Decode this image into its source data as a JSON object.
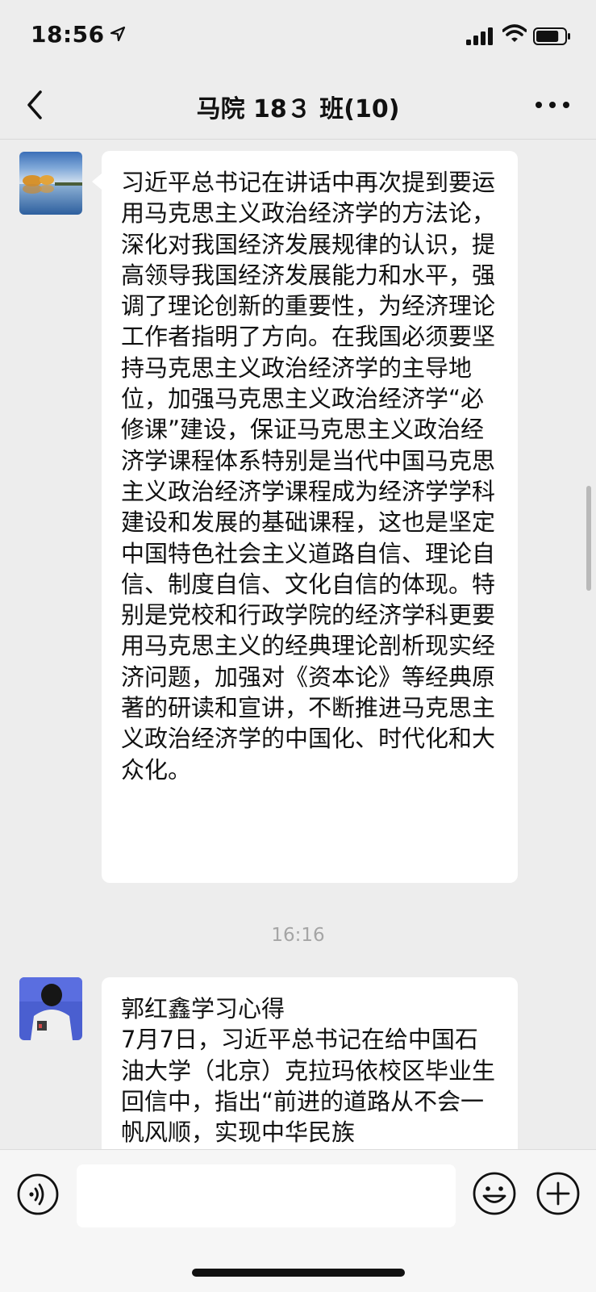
{
  "status_bar": {
    "time": "18:56",
    "location_icon": "location-arrow-icon",
    "battery_level": 0.8
  },
  "nav": {
    "title": "马院 18３ 班(10)",
    "back_icon": "chevron-left-icon",
    "more_icon": "ellipsis-icon"
  },
  "messages": [
    {
      "avatar": "landscape-avatar",
      "text": "习近平总书记在讲话中再次提到要运用马克思主义政治经济学的方法论，深化对我国经济发展规律的认识，提高领导我国经济发展能力和水平，强调了理论创新的重要性，为经济理论工作者指明了方向。在我国必须要坚持马克思主义政治经济学的主导地位，加强马克思主义政治经济学“必修课”建设，保证马克思主义政治经济学课程体系特别是当代中国马克思主义政治经济学课程成为经济学学科建设和发展的基础课程，这也是坚定中国特色社会主义道路自信、理论自信、制度自信、文化自信的体现。特别是党校和行政学院的经济学科更要用马克思主义的经典理论剖析现实经济问题，加强对《资本论》等经典原著的研读和宣讲，不断推进马克思主义政治经济学的中国化、时代化和大众化。"
    },
    {
      "timestamp": "16:16",
      "avatar": "person-avatar",
      "text": "郭红鑫学习心得\n7月7日，习近平总书记在给中国石油大学（北京）克拉玛依校区毕业生回信中，指出“前进的道路从不会一帆风顺，实现中华民族"
    }
  ],
  "input_bar": {
    "placeholder": "",
    "voice_icon": "voice-icon",
    "emoji_icon": "emoji-icon",
    "plus_icon": "plus-icon"
  },
  "colors": {
    "background": "#ededed",
    "bubble": "#ffffff",
    "timestamp": "#a5a5a5"
  }
}
